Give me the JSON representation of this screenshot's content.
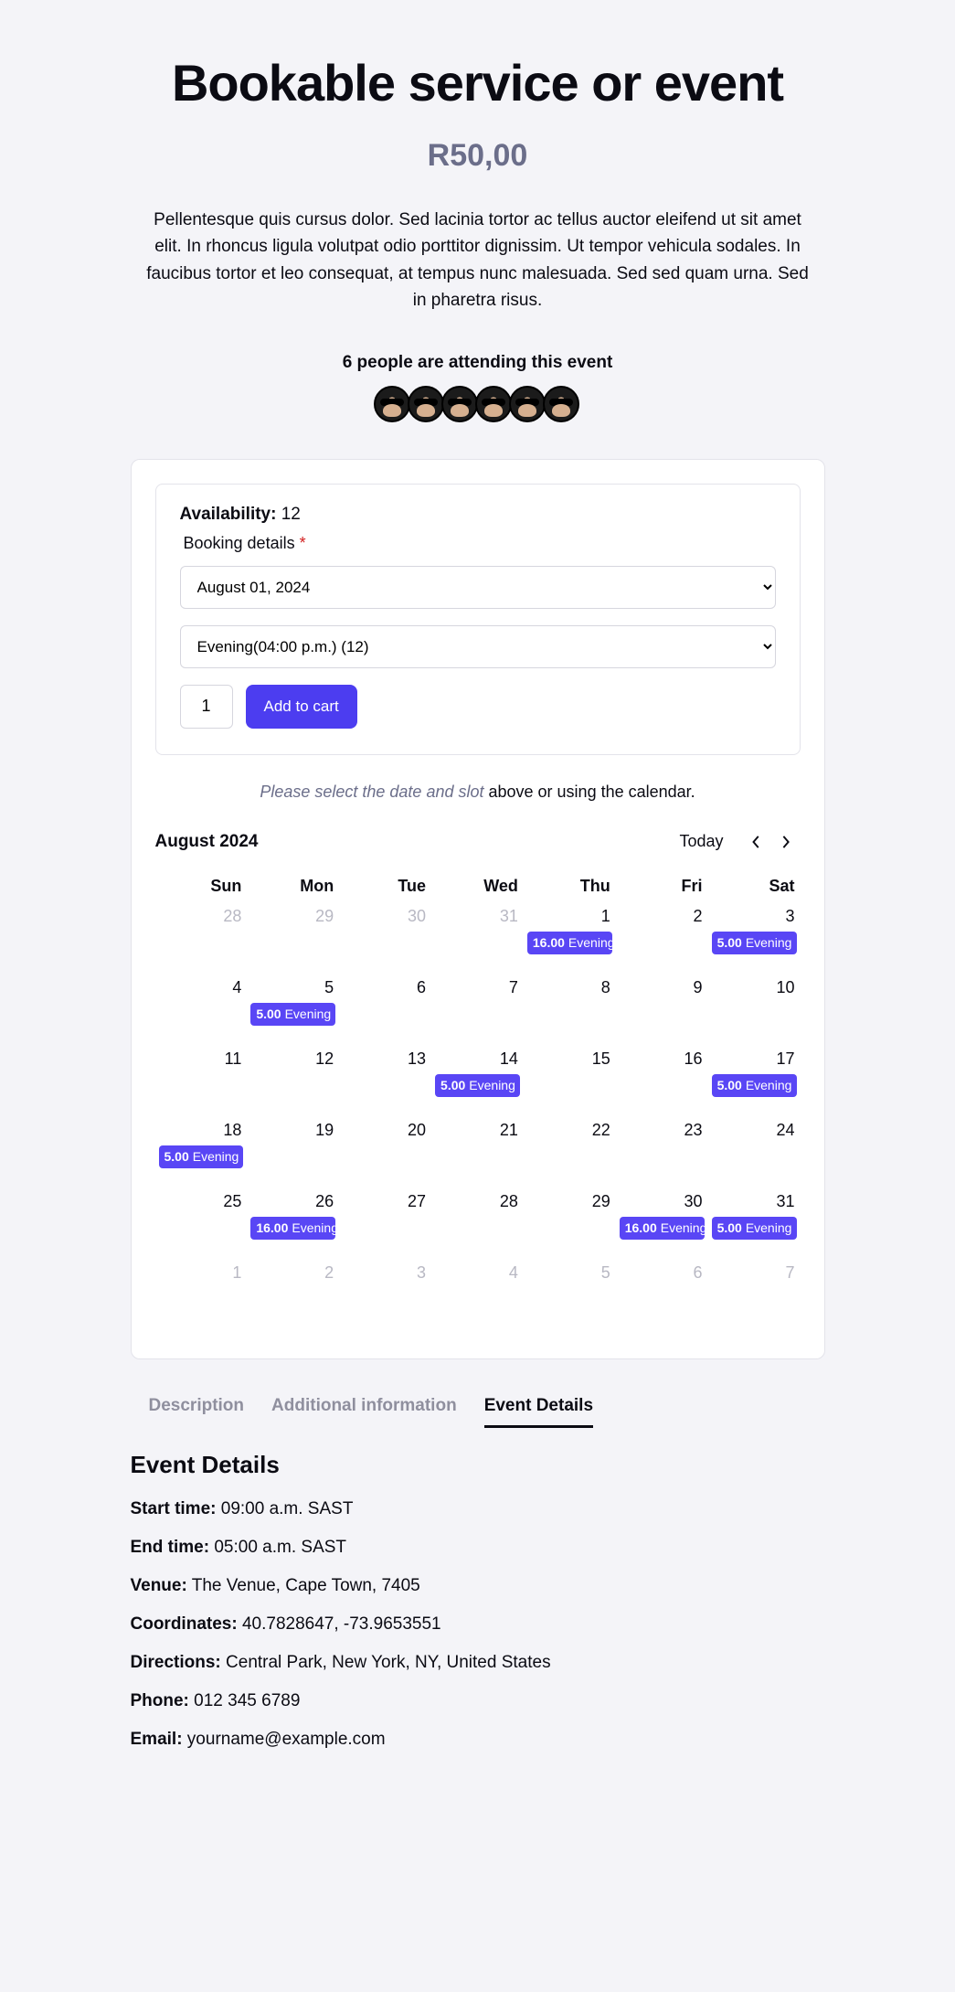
{
  "header": {
    "title": "Bookable service or event",
    "price": "R50,00",
    "description": "Pellentesque quis cursus dolor. Sed lacinia tortor ac tellus auctor eleifend ut sit amet elit. In rhoncus ligula volutpat odio porttitor dignissim. Ut tempor vehicula sodales. In faucibus tortor et leo consequat, at tempus nunc malesuada. Sed sed quam urna. Sed in pharetra risus.",
    "attending_text": "6 people are attending this event"
  },
  "booking": {
    "availability_label": "Availability:",
    "availability_value": "12",
    "section_label": "Booking details",
    "date_options": [
      "August 01, 2024"
    ],
    "date_selected": "August 01, 2024",
    "slot_options": [
      "Evening(04:00 p.m.) (12)"
    ],
    "slot_selected": "Evening(04:00 p.m.) (12)",
    "qty": "1",
    "add_label": "Add to cart"
  },
  "hint": {
    "emph": "Please select the date and slot",
    "rest": " above or using the calendar."
  },
  "calendar": {
    "title": "August 2024",
    "today_label": "Today",
    "weekdays": [
      "Sun",
      "Mon",
      "Tue",
      "Wed",
      "Thu",
      "Fri",
      "Sat"
    ],
    "weeks": [
      [
        {
          "n": "28",
          "other": true
        },
        {
          "n": "29",
          "other": true
        },
        {
          "n": "30",
          "other": true
        },
        {
          "n": "31",
          "other": true
        },
        {
          "n": "1",
          "badge": {
            "amt": "16.00",
            "txt": "Evening"
          }
        },
        {
          "n": "2"
        },
        {
          "n": "3",
          "badge": {
            "amt": "5.00",
            "txt": "Evening"
          }
        }
      ],
      [
        {
          "n": "4"
        },
        {
          "n": "5",
          "badge": {
            "amt": "5.00",
            "txt": "Evening"
          }
        },
        {
          "n": "6"
        },
        {
          "n": "7"
        },
        {
          "n": "8"
        },
        {
          "n": "9"
        },
        {
          "n": "10"
        }
      ],
      [
        {
          "n": "11"
        },
        {
          "n": "12"
        },
        {
          "n": "13"
        },
        {
          "n": "14",
          "badge": {
            "amt": "5.00",
            "txt": "Evening"
          }
        },
        {
          "n": "15"
        },
        {
          "n": "16"
        },
        {
          "n": "17",
          "badge": {
            "amt": "5.00",
            "txt": "Evening"
          }
        }
      ],
      [
        {
          "n": "18",
          "badge": {
            "amt": "5.00",
            "txt": "Evening"
          }
        },
        {
          "n": "19"
        },
        {
          "n": "20"
        },
        {
          "n": "21"
        },
        {
          "n": "22"
        },
        {
          "n": "23"
        },
        {
          "n": "24"
        }
      ],
      [
        {
          "n": "25"
        },
        {
          "n": "26",
          "badge": {
            "amt": "16.00",
            "txt": "Evening"
          }
        },
        {
          "n": "27"
        },
        {
          "n": "28"
        },
        {
          "n": "29"
        },
        {
          "n": "30",
          "badge": {
            "amt": "16.00",
            "txt": "Evening"
          }
        },
        {
          "n": "31",
          "badge": {
            "amt": "5.00",
            "txt": "Evening"
          }
        }
      ],
      [
        {
          "n": "1",
          "other": true
        },
        {
          "n": "2",
          "other": true
        },
        {
          "n": "3",
          "other": true
        },
        {
          "n": "4",
          "other": true
        },
        {
          "n": "5",
          "other": true
        },
        {
          "n": "6",
          "other": true
        },
        {
          "n": "7",
          "other": true
        }
      ]
    ]
  },
  "tabs": {
    "items": [
      "Description",
      "Additional information",
      "Event Details"
    ],
    "active": 2
  },
  "event_details": {
    "heading": "Event Details",
    "rows": [
      {
        "label": "Start time:",
        "value": "09:00 a.m. SAST"
      },
      {
        "label": "End time:",
        "value": "05:00 a.m. SAST"
      },
      {
        "label": "Venue:",
        "value": "The Venue, Cape Town, 7405"
      },
      {
        "label": "Coordinates:",
        "value": "40.7828647, -73.9653551"
      },
      {
        "label": "Directions:",
        "value": "Central Park, New York, NY, United States"
      },
      {
        "label": "Phone:",
        "value": "012 345 6789"
      },
      {
        "label": "Email:",
        "value": "yourname@example.com"
      }
    ]
  }
}
